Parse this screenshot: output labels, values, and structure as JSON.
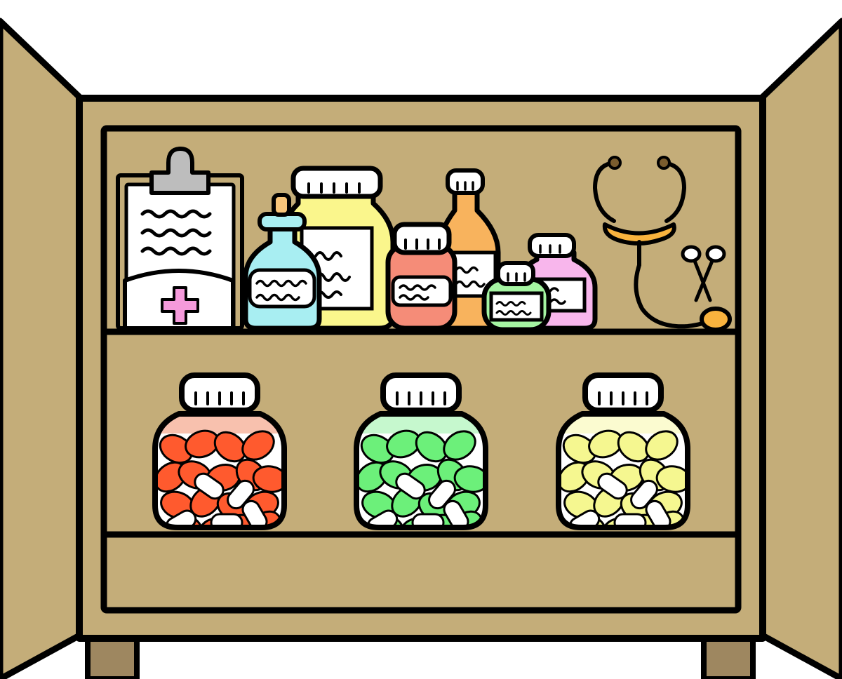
{
  "scene": {
    "subject": "medicine-cabinet",
    "colors": {
      "outline": "#000000",
      "wood": "#C4AD79",
      "wood_dark": "#9E8760",
      "background": "#FFFFFF",
      "clip": "#BDBDBD",
      "cross": "#F59ADB",
      "blue_bottle": "#A8EEF2",
      "yellow_bottle": "#FAF68C",
      "salmon_bottle": "#F58C78",
      "amber_bottle": "#F8B35D",
      "green_bottle": "#A5F5A2",
      "pink_bottle": "#F8B6EC",
      "stethoscope": "#F9B33E",
      "pill_red": "#FF5A2E",
      "pill_green": "#6CF07A",
      "pill_yellow": "#F5F790",
      "jar_red_tint": "#F8C1AE",
      "jar_green_tint": "#C6F8CE",
      "jar_yellow_tint": "#FBFBD0"
    },
    "icons": [
      "clipboard-icon",
      "blue-bottle-icon",
      "yellow-bottle-icon",
      "salmon-bottle-icon",
      "amber-bottle-icon",
      "green-bottle-icon",
      "pink-bottle-icon",
      "stethoscope-icon",
      "scissors-icon",
      "red-pill-jar-icon",
      "green-pill-jar-icon",
      "yellow-pill-jar-icon"
    ]
  }
}
